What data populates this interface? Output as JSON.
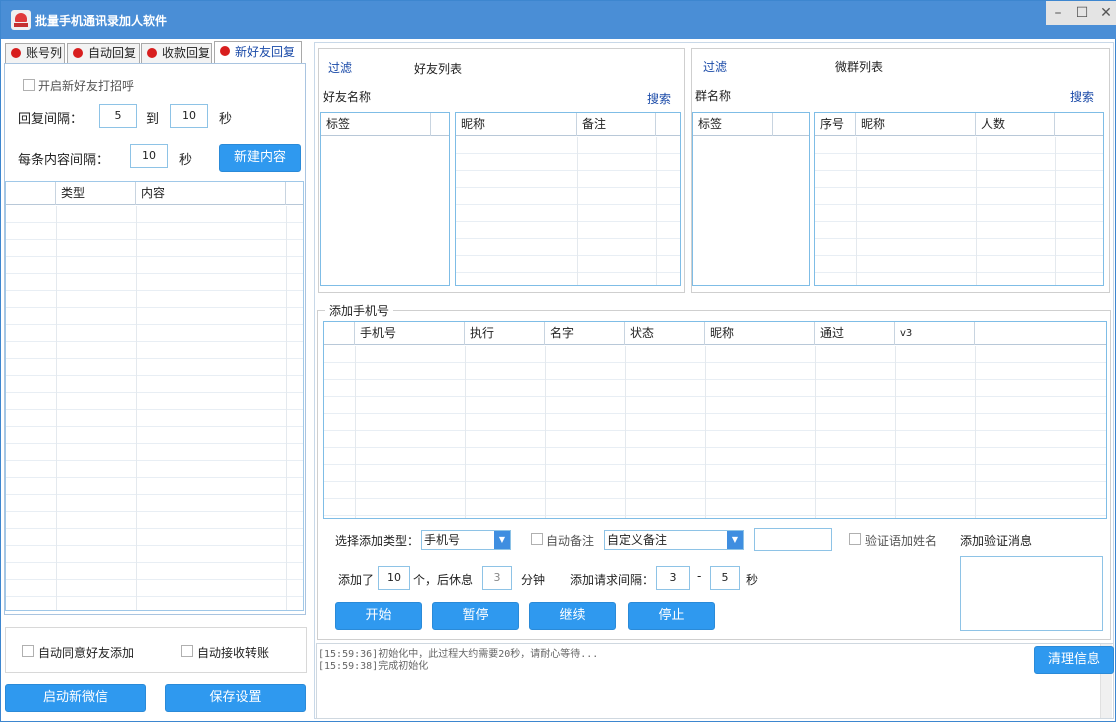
{
  "window": {
    "title": "批量手机通讯录加人软件"
  },
  "tabs": [
    {
      "label": "账号列"
    },
    {
      "label": "自动回复"
    },
    {
      "label": "收款回复"
    },
    {
      "label": "新好友回复"
    }
  ],
  "left": {
    "greet_checkbox": "开启新好友打招呼",
    "reply_interval_label": "回复间隔：",
    "reply_from": "5",
    "reply_to_label": "到",
    "reply_to": "10",
    "sec1": "秒",
    "content_interval_label": "每条内容间隔：",
    "content_interval": "10",
    "sec2": "秒",
    "new_content_button": "新建内容",
    "grid_headers": [
      "",
      "类型",
      "内容"
    ],
    "auto_accept": "自动同意好友添加",
    "auto_transfer": "自动接收转账",
    "start_wechat_button": "启动新微信",
    "save_button": "保存设置"
  },
  "friends": {
    "filter": "过滤",
    "title": "好友列表",
    "name_label": "好友名称",
    "search": "搜索",
    "tag_header": "标签",
    "headers": [
      "昵称",
      "备注"
    ]
  },
  "groups": {
    "filter": "过滤",
    "title": "微群列表",
    "name_label": "群名称",
    "search": "搜索",
    "tag_header": "标签",
    "headers": [
      "序号",
      "昵称",
      "人数"
    ]
  },
  "add_phone": {
    "legend": "添加手机号",
    "headers": [
      "",
      "手机号",
      "执行",
      "名字",
      "状态",
      "昵称",
      "通过",
      "v3"
    ],
    "type_label": "选择添加类型：",
    "type_value": "手机号",
    "auto_remark": "自动备注",
    "remark_value": "自定义备注",
    "verify_name": "验证语加姓名",
    "verify_msg_label": "添加验证消息",
    "added_label": "添加了",
    "added_count": "10",
    "rest_label": "个，后休息",
    "rest_minutes": "3",
    "minutes_label": "分钟",
    "interval_label": "添加请求间隔：",
    "interval_from": "3",
    "dash": "-",
    "interval_to": "5",
    "sec": "秒",
    "start": "开始",
    "pause": "暂停",
    "resume": "继续",
    "stop": "停止"
  },
  "log": {
    "lines": [
      "[15:59:36]初始化中，此过程大约需要20秒，请耐心等待...",
      "[15:59:38]完成初始化"
    ],
    "clear_button": "清理信息"
  },
  "colors": {
    "title_bar": "#4a8ed6",
    "button": "#2f99ef",
    "link": "#1a4aa8"
  }
}
